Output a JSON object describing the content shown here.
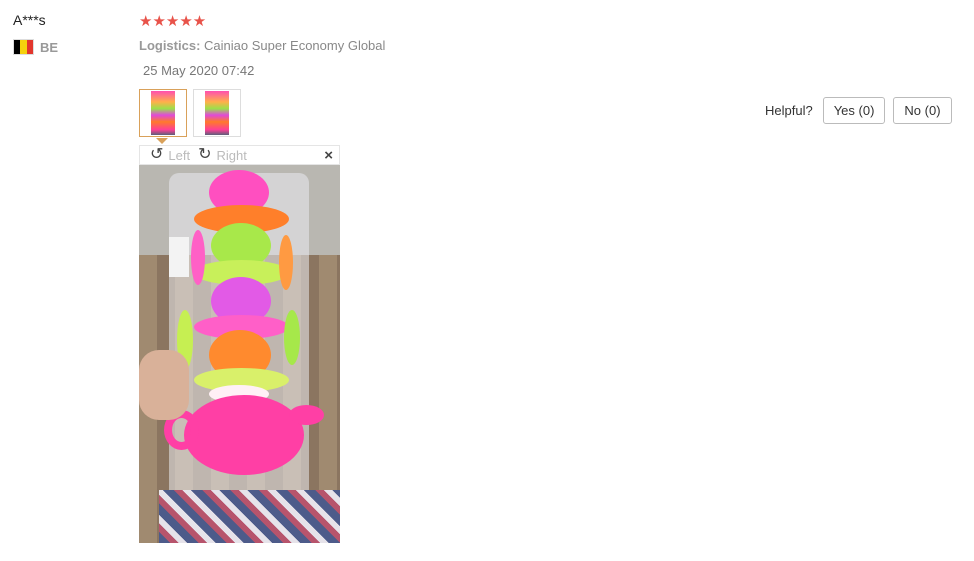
{
  "review": {
    "user_name": "A***s",
    "country_code": "BE",
    "flag_colors": [
      "#000000",
      "#f5d10d",
      "#e2362d"
    ],
    "rating_stars": 5,
    "star_glyph": "★★★★★",
    "logistics_label": "Logistics:",
    "logistics_value": "Cainiao Super Economy Global",
    "date": "25 May 2020 07:42"
  },
  "helpful": {
    "label": "Helpful?",
    "yes": "Yes (0)",
    "no": "No (0)"
  },
  "viewer": {
    "rotate_left": "Left",
    "rotate_right": "Right",
    "rotate_left_icon": "↺",
    "rotate_right_icon": "↻",
    "close_icon": "×"
  },
  "colors": {
    "star": "#e8534a",
    "active_thumb": "#d9a15a"
  }
}
